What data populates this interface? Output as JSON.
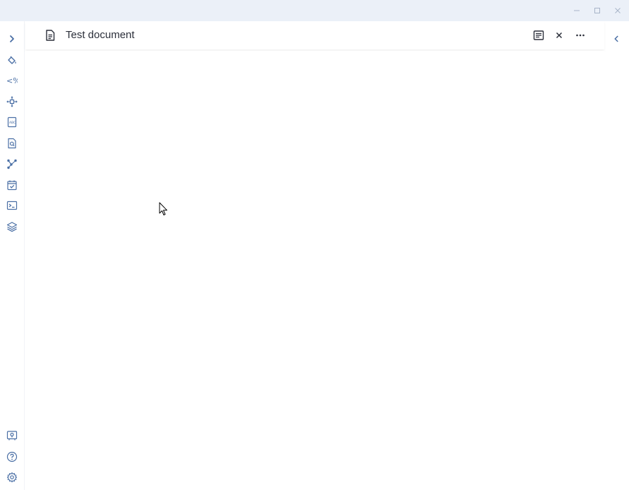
{
  "window": {
    "controls": [
      {
        "name": "minimize",
        "icon": "minimize-icon"
      },
      {
        "name": "maximize",
        "icon": "maximize-icon"
      },
      {
        "name": "close",
        "icon": "close-icon"
      }
    ]
  },
  "sidebar": {
    "top_items": [
      {
        "name": "expand",
        "icon": "chevron-right-icon"
      },
      {
        "name": "style",
        "icon": "paint-bucket-icon"
      },
      {
        "name": "template",
        "icon": "template-tag-icon"
      },
      {
        "name": "move",
        "icon": "move-icon"
      },
      {
        "name": "spellcheck",
        "icon": "abc-icon"
      },
      {
        "name": "search-document",
        "icon": "document-search-icon"
      },
      {
        "name": "graph",
        "icon": "graph-icon"
      },
      {
        "name": "tasks",
        "icon": "calendar-check-icon"
      },
      {
        "name": "terminal",
        "icon": "terminal-icon"
      },
      {
        "name": "layers",
        "icon": "layers-icon"
      }
    ],
    "bottom_items": [
      {
        "name": "vault",
        "icon": "vault-icon"
      },
      {
        "name": "help",
        "icon": "help-icon"
      },
      {
        "name": "settings",
        "icon": "gear-icon"
      }
    ]
  },
  "document": {
    "title": "Test document",
    "icon": "document-icon"
  },
  "header_actions": [
    {
      "name": "reading-view",
      "icon": "reading-view-icon"
    },
    {
      "name": "close-tab",
      "icon": "close-icon"
    },
    {
      "name": "more-options",
      "icon": "more-horizontal-icon"
    }
  ],
  "colors": {
    "accent": "#4a6fa5",
    "titlebar": "#ebf0f8",
    "text": "#2b2f3a",
    "window_controls": "#a8b4c8"
  }
}
